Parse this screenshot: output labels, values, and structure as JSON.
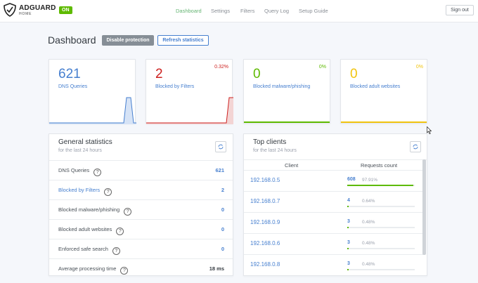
{
  "header": {
    "brand": "ADGUARD",
    "brand_sub": "HOME",
    "status_badge": "ON",
    "nav": [
      "Dashboard",
      "Settings",
      "Filters",
      "Query Log",
      "Setup Guide"
    ],
    "signout_label": "Sign out"
  },
  "page": {
    "title": "Dashboard",
    "disable_label": "Disable protection",
    "refresh_label": "Refresh statistics"
  },
  "stats": [
    {
      "value": "621",
      "label": "DNS Queries",
      "percent": "",
      "color": "#467fcf"
    },
    {
      "value": "2",
      "label": "Blocked by Filters",
      "percent": "0.32%",
      "color": "#cd201f"
    },
    {
      "value": "0",
      "label": "Blocked malware/phishing",
      "percent": "0%",
      "color": "#5eba00"
    },
    {
      "value": "0",
      "label": "Blocked adult websites",
      "percent": "0%",
      "color": "#f1c40f"
    }
  ],
  "general": {
    "title": "General statistics",
    "subtitle": "for the last 24 hours",
    "rows": [
      {
        "label": "DNS Queries",
        "value": "621"
      },
      {
        "label": "Blocked by Filters",
        "value": "2"
      },
      {
        "label": "Blocked malware/phishing",
        "value": "0"
      },
      {
        "label": "Blocked adult websites",
        "value": "0"
      },
      {
        "label": "Enforced safe search",
        "value": "0"
      },
      {
        "label": "Average processing time",
        "value": "18 ms"
      }
    ]
  },
  "clients": {
    "title": "Top clients",
    "subtitle": "for the last 24 hours",
    "col_client": "Client",
    "col_requests": "Requests count",
    "rows": [
      {
        "ip": "192.168.0.5",
        "count": "608",
        "percent": "97.91%",
        "fraction": 0.9791
      },
      {
        "ip": "192.168.0.7",
        "count": "4",
        "percent": "0.64%",
        "fraction": 0.0064
      },
      {
        "ip": "192.168.0.9",
        "count": "3",
        "percent": "0.48%",
        "fraction": 0.0048
      },
      {
        "ip": "192.168.0.6",
        "count": "3",
        "percent": "0.48%",
        "fraction": 0.0048
      },
      {
        "ip": "192.168.0.8",
        "count": "3",
        "percent": "0.48%",
        "fraction": 0.0048
      }
    ]
  }
}
